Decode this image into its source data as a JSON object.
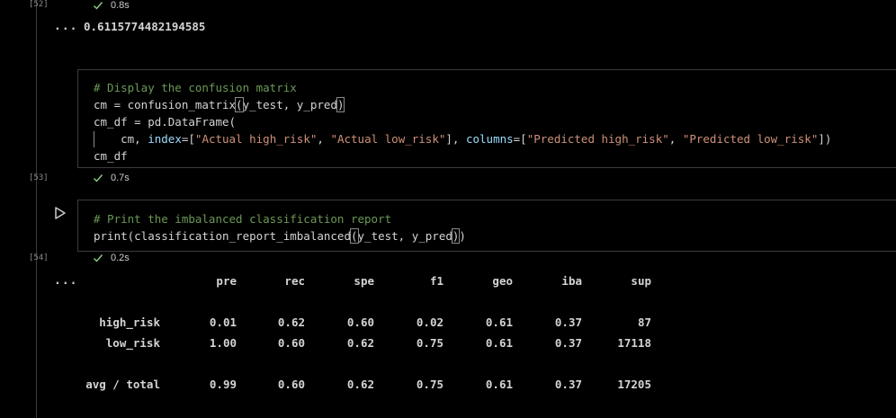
{
  "cells": [
    {
      "exec_count": "[52]",
      "time": "0.8s"
    },
    {
      "exec_count": "[53]",
      "time": "0.7s"
    },
    {
      "exec_count": "[54]",
      "time": "0.2s"
    }
  ],
  "output1": {
    "ellipsis": "...",
    "value": "0.6115774482194585"
  },
  "cell53_code": {
    "comment": "# Display the confusion matrix",
    "l2_a": "cm = confusion_matrix",
    "l2_b": "(",
    "l2_c": "y_test, y_pred",
    "l2_d": ")",
    "l3": "cm_df = pd.DataFrame(",
    "l4_a": "    cm, ",
    "l4_p1": "index",
    "l4_eq1": "=[",
    "l4_s1": "\"Actual high_risk\"",
    "l4_c1": ", ",
    "l4_s2": "\"Actual low_risk\"",
    "l4_c2": "], ",
    "l4_p2": "columns",
    "l4_eq2": "=[",
    "l4_s3": "\"Predicted high_risk\"",
    "l4_c3": ", ",
    "l4_s4": "\"Predicted low_risk\"",
    "l4_end": "])",
    "l5": "cm_df"
  },
  "cell54_code": {
    "comment": "# Print the imbalanced classification report",
    "l2_a": "print(classification_report_imbalanced",
    "l2_b": "(",
    "l2_c": "y_test, y_pred",
    "l2_d": ")",
    "l2_e": ")"
  },
  "report": {
    "ellipsis": "...",
    "headers": [
      "pre",
      "rec",
      "spe",
      "f1",
      "geo",
      "iba",
      "sup"
    ],
    "rows": [
      {
        "label": "high_risk",
        "values": [
          "0.01",
          "0.62",
          "0.60",
          "0.02",
          "0.61",
          "0.37",
          "87"
        ]
      },
      {
        "label": "low_risk",
        "values": [
          "1.00",
          "0.60",
          "0.62",
          "0.75",
          "0.61",
          "0.37",
          "17118"
        ]
      },
      {
        "label": "avg / total",
        "values": [
          "0.99",
          "0.60",
          "0.62",
          "0.75",
          "0.61",
          "0.37",
          "17205"
        ]
      }
    ]
  },
  "icons": {
    "run": "run-play-icon",
    "check": "success-check-icon"
  },
  "colors": {
    "comment": "#6a9955",
    "string": "#ce9178",
    "param": "#9cdcfe",
    "check": "#89d185",
    "border": "#3c3c3c"
  }
}
